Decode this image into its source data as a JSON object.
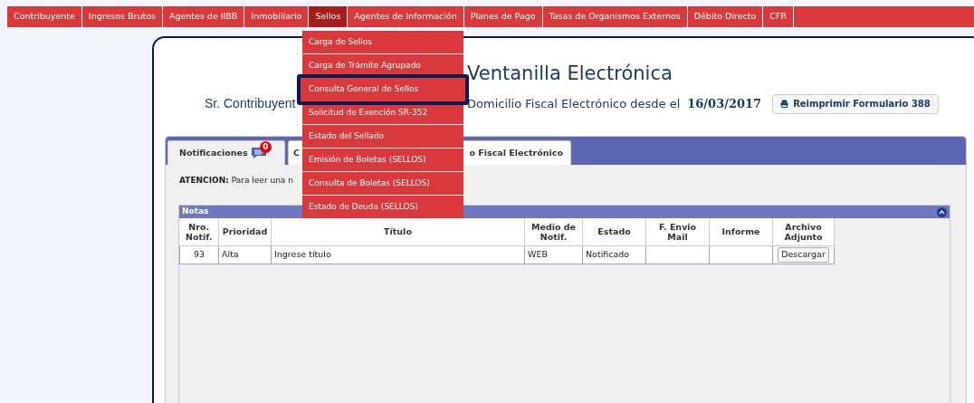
{
  "nav": [
    {
      "label": "Contribuyente",
      "selected": false
    },
    {
      "label": "Ingresos Brutos",
      "selected": false
    },
    {
      "label": "Agentes de IIBB",
      "selected": false
    },
    {
      "label": "Inmobiliario",
      "selected": false
    },
    {
      "label": "Sellos",
      "selected": true
    },
    {
      "label": "Agentes de Información",
      "selected": false
    },
    {
      "label": "Planes de Pago",
      "selected": false
    },
    {
      "label": "Tasas de Organismos Externos",
      "selected": false
    },
    {
      "label": "Débito Directo",
      "selected": false
    },
    {
      "label": "CFR",
      "selected": false
    }
  ],
  "dropdown": [
    {
      "label": "Carga de Sellos",
      "selected": false
    },
    {
      "label": "Carga de Trámite Agrupado",
      "selected": false
    },
    {
      "label": "Consulta General de Sellos",
      "selected": true
    },
    {
      "label": "Solicitud de Exención SR-352",
      "selected": false
    },
    {
      "label": "Estado del Sellado",
      "selected": false
    },
    {
      "label": "Emisión de Boletas (SELLOS)",
      "selected": false
    },
    {
      "label": "Consulta de Boletas (SELLOS)",
      "selected": false
    },
    {
      "label": "Estado de Deuda (SELLOS)",
      "selected": false
    }
  ],
  "page_title": "Ventanilla Electrónica",
  "subtitle": {
    "start": "Sr. Contribuyent",
    "end": "Domicilio Fiscal Electrónico desde el",
    "date": "16/03/2017",
    "button": "Reimprimir Formulario 388"
  },
  "tabs": [
    {
      "label": "Notificaciones",
      "badge": "0",
      "selected": true
    },
    {
      "label": "C",
      "label_end": "o Fiscal Electrónico",
      "selected": false
    }
  ],
  "notice": "**ATENCION:** Para leer una n",
  "notes": {
    "title": "Notas",
    "columns": [
      "Nro. Notif.",
      "Prioridad",
      "Título",
      "Medio de Notif.",
      "Estado",
      "F. Envio Mail",
      "Informe",
      "Archivo Adjunto"
    ],
    "rows": [
      {
        "cells": [
          "93",
          "Alta",
          "Ingrese título",
          "WEB",
          "Notificado",
          "",
          ""
        ],
        "action": "Descargar"
      }
    ]
  }
}
